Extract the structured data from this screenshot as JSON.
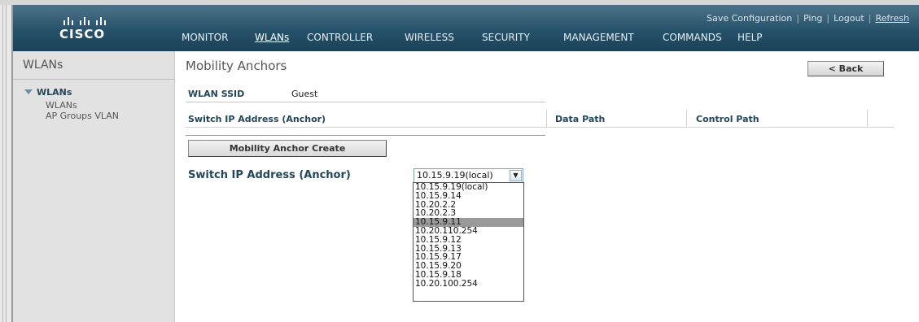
{
  "brand": {
    "name": "CISCO"
  },
  "toplinks": {
    "save": "Save Configuration",
    "ping": "Ping",
    "logout": "Logout",
    "refresh": "Refresh"
  },
  "nav": {
    "monitor": "MONITOR",
    "wlans": "WLANs",
    "controller": "CONTROLLER",
    "wireless": "WIRELESS",
    "security": "SECURITY",
    "management": "MANAGEMENT",
    "commands": "COMMANDS",
    "help": "HELP"
  },
  "sidebar": {
    "title": "WLANs",
    "section": "WLANs",
    "items": [
      "WLANs",
      "AP Groups VLAN"
    ]
  },
  "main": {
    "title": "Mobility Anchors",
    "back_label": "< Back",
    "wlan_ssid_label": "WLAN SSID",
    "wlan_ssid_value": "Guest",
    "table_headers": [
      "Switch IP Address (Anchor)",
      "Data Path",
      "Control Path"
    ],
    "create_label": "Mobility Anchor Create",
    "switch_ip_label": "Switch IP Address (Anchor)",
    "selected_value": "10.15.9.19(local)",
    "options": [
      "10.15.9.19(local)",
      "10.15.9.14",
      "10.20.2.2",
      "10.20.2.3",
      "10.15.9.11",
      "10.20.110.254",
      "10.15.9.12",
      "10.15.9.13",
      "10.15.9.17",
      "10.15.9.20",
      "10.15.9.18",
      "10.20.100.254"
    ],
    "highlighted_option": "10.15.9.11"
  },
  "colors": {
    "header": "#27526b",
    "label": "#23465a",
    "sidebar": "#e2e2e2"
  }
}
